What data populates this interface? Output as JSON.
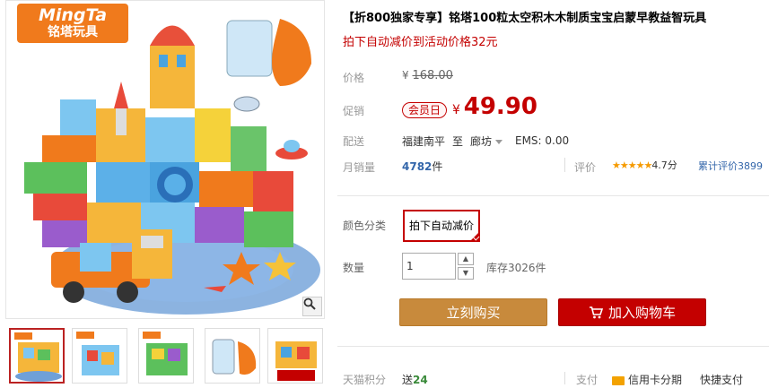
{
  "brand": {
    "en": "MingTa",
    "cn": "铭塔玩具"
  },
  "product": {
    "title": "【折800独家专享】铭塔100粒太空积木木制质宝宝启蒙早教益智玩具",
    "subtitle": "拍下自动减价到活动价格32元"
  },
  "price": {
    "label": "价格",
    "currency": "¥",
    "original": "168.00"
  },
  "promo": {
    "label": "促销",
    "badge": "会员日",
    "currency": "¥",
    "price": "49.90"
  },
  "shipping": {
    "label": "配送",
    "from": "福建南平",
    "to_word": "至",
    "to": "廊坊",
    "fee": "EMS: 0.00"
  },
  "sales": {
    "label": "月销量",
    "count": "4782",
    "unit": "件",
    "rating_label": "评价",
    "stars": "★★★★★",
    "score": "4.7分",
    "rating": 4.7,
    "total_reviews": "累计评价3899"
  },
  "sku": {
    "label": "颜色分类",
    "option": "拍下自动减价"
  },
  "quantity": {
    "label": "数量",
    "value": "1",
    "stock": "库存3026件"
  },
  "buttons": {
    "buy_now": "立刻购买",
    "add_cart": "加入购物车"
  },
  "bottom": {
    "points_label": "天猫积分",
    "points_prefix": "送",
    "points_value": "24",
    "pay_label": "支付",
    "credit_card": "信用卡分期",
    "express_pay": "快捷支付"
  },
  "thumbnails": [
    {
      "name": "thumb-1",
      "selected": true
    },
    {
      "name": "thumb-2",
      "selected": false
    },
    {
      "name": "thumb-3",
      "selected": false
    },
    {
      "name": "thumb-4",
      "selected": false
    },
    {
      "name": "thumb-5",
      "selected": false
    }
  ],
  "colors": {
    "accent": "#c40000",
    "buy_button": "#c88a3c",
    "brand_orange": "#f07a1c",
    "link_blue": "#3366aa",
    "star": "#f59a00"
  },
  "icons": {
    "zoom": "magnifier-icon",
    "cart": "cart-icon",
    "card": "credit-card-icon"
  }
}
